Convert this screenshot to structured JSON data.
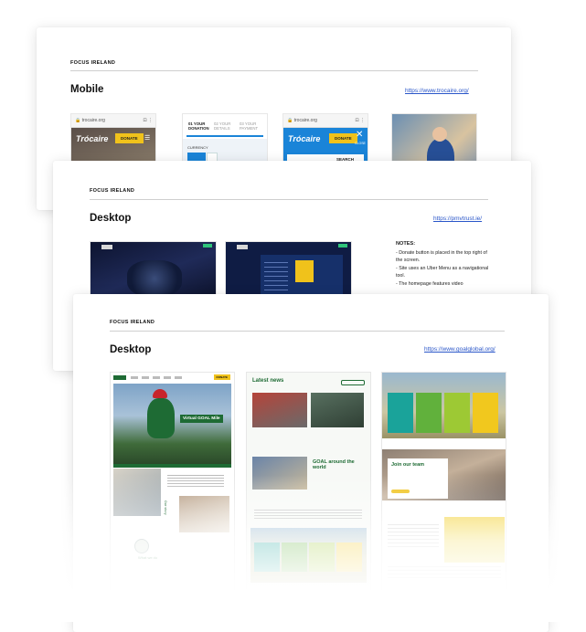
{
  "cards": [
    {
      "brand": "FOCUS IRELAND",
      "title": "Mobile",
      "link": "https://www.trocaire.org/"
    },
    {
      "brand": "FOCUS IRELAND",
      "title": "Desktop",
      "link": "https://pmvtrust.ie/"
    },
    {
      "brand": "FOCUS IRELAND",
      "title": "Desktop",
      "link": "https://www.goalglobal.org/"
    }
  ],
  "mobile": {
    "url_label": "trocaire.org",
    "logo": "Trócaire",
    "donate": "DONATE",
    "close": "CLOSE",
    "search": "SEARCH",
    "steps": [
      "01 YOUR DONATION",
      "02 YOUR DETAILS",
      "03 YOUR PAYMENT"
    ],
    "currency": "CURRENCY"
  },
  "notes": {
    "heading": "NOTES:",
    "items": [
      "- Donate button is placed in the top right of the screen.",
      "- Site uses an Uber Menu as a navigational tool.",
      "- The homepage features video"
    ]
  },
  "goal": {
    "hero_caption": "Virtual GOAL Mile",
    "donate": "DONATE",
    "latest_news": "Latest news",
    "around_world": "GOAL around the world",
    "join_team": "Join our team",
    "what_we_do": "What we do",
    "our_story": "Our story"
  },
  "colors": {
    "goal_green": "#1e6b34",
    "donate_yellow": "#f0c21b",
    "trocaire_blue": "#1a84d8"
  }
}
